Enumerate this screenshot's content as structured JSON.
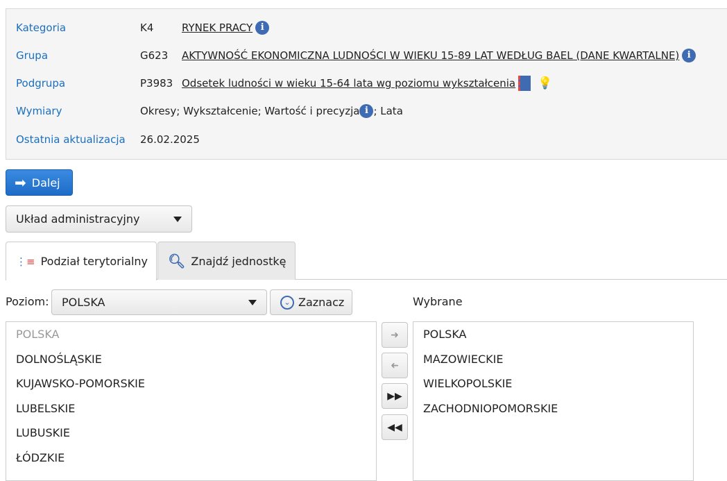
{
  "info": {
    "rows": [
      {
        "label": "Kategoria",
        "code": "K4",
        "text": "RYNEK PRACY"
      },
      {
        "label": "Grupa",
        "code": "G623",
        "text": "AKTYWNOŚĆ EKONOMICZNA LUDNOŚCI W WIEKU 15-89 LAT WEDŁUG BAEL (DANE KWARTALNE)"
      },
      {
        "label": "Podgrupa",
        "code": "P3983",
        "text": "Odsetek ludności w wieku 15-64 lata wg poziomu wykształcenia"
      },
      {
        "label": "Wymiary",
        "text_a": "Okresy; Wykształcenie; Wartość i precyzja",
        "text_b": "; Lata"
      },
      {
        "label": "Ostatnia aktualizacja",
        "code": "26.02.2025"
      }
    ]
  },
  "dalej": "Dalej",
  "uklad": "Układ administracyjny",
  "tabs": [
    "Podział terytorialny",
    "Znajdź jednostkę"
  ],
  "poziom_label": "Poziom:",
  "poziom_value": "POLSKA",
  "zaznacz": "Zaznacz",
  "wybrane_label": "Wybrane",
  "available": [
    "POLSKA",
    "DOLNOŚLĄSKIE",
    "KUJAWSKO-POMORSKIE",
    "LUBELSKIE",
    "LUBUSKIE",
    "ŁÓDZKIE"
  ],
  "selected": [
    "POLSKA",
    "MAZOWIECKIE",
    "WIELKOPOLSKIE",
    "ZACHODNIOPOMORSKIE"
  ]
}
